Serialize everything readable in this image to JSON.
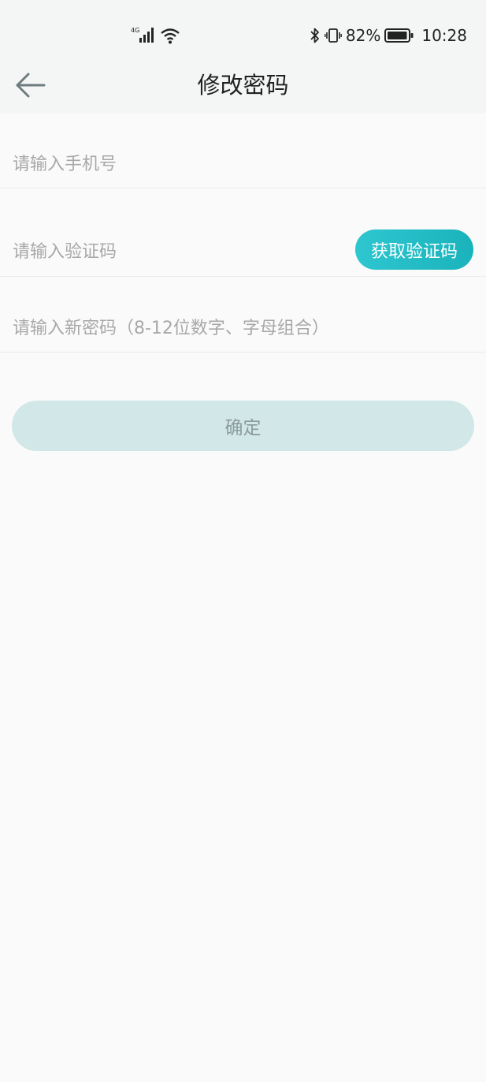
{
  "status_bar": {
    "network_label": "4G",
    "battery_percent": "82%",
    "time": "10:28",
    "icons": [
      "signal-icon",
      "wifi-icon",
      "bluetooth-icon",
      "vibrate-icon",
      "battery-icon"
    ]
  },
  "header": {
    "title": "修改密码",
    "back_icon": "arrow-left-icon"
  },
  "form": {
    "phone_placeholder": "请输入手机号",
    "code_placeholder": "请输入验证码",
    "get_code_label": "获取验证码",
    "password_placeholder": "请输入新密码（8-12位数字、字母组合）",
    "confirm_label": "确定"
  },
  "colors": {
    "accent": "#1ab3bc",
    "confirm_disabled_bg": "#d2e7e8",
    "confirm_disabled_text": "#8c9b9c",
    "header_bg": "#f4f6f5",
    "page_bg": "#fafafa"
  }
}
